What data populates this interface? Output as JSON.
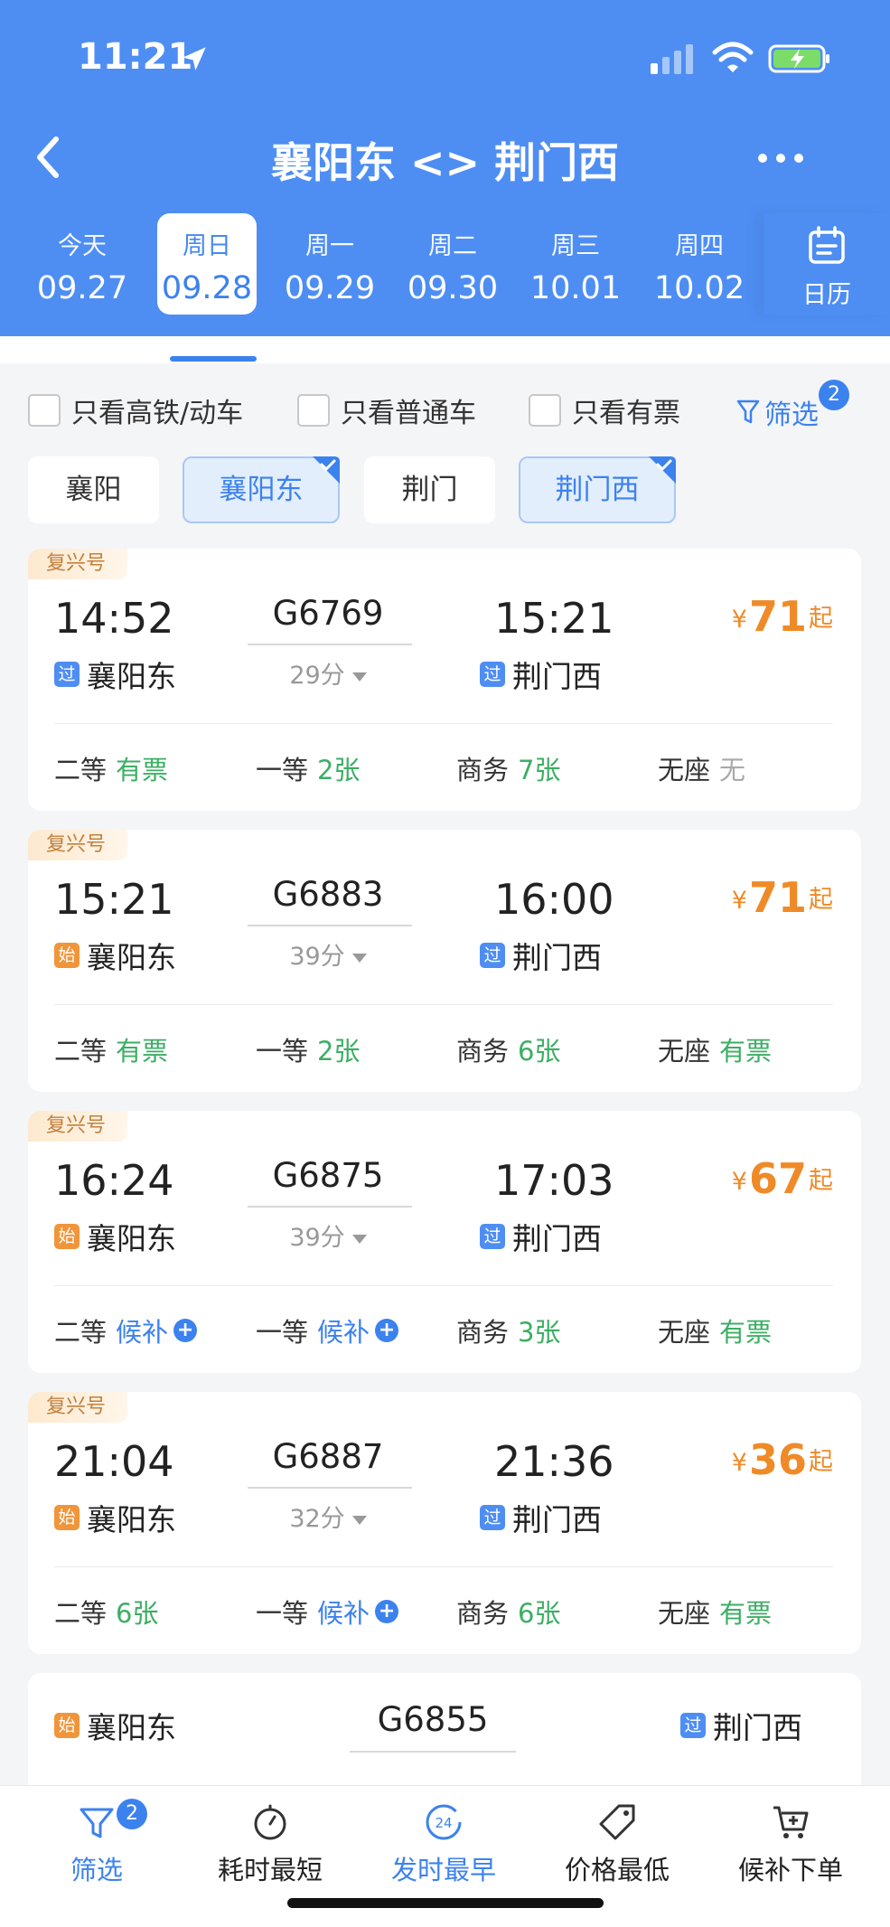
{
  "status": {
    "time": "11:21"
  },
  "nav": {
    "title": "襄阳东 <> 荆门西"
  },
  "dates": [
    {
      "weekday": "今天",
      "date": "09.27"
    },
    {
      "weekday": "周日",
      "date": "09.28",
      "selected": true
    },
    {
      "weekday": "周一",
      "date": "09.29"
    },
    {
      "weekday": "周二",
      "date": "09.30"
    },
    {
      "weekday": "周三",
      "date": "10.01"
    },
    {
      "weekday": "周四",
      "date": "10.02"
    }
  ],
  "calendar_label": "日历",
  "filters": {
    "high_speed": "只看高铁/动车",
    "regular": "只看普通车",
    "available": "只看有票",
    "filter_label": "筛选",
    "filter_count": "2"
  },
  "stations": [
    {
      "name": "襄阳",
      "selected": false
    },
    {
      "name": "襄阳东",
      "selected": true
    },
    {
      "name": "荆门",
      "selected": false
    },
    {
      "name": "荆门西",
      "selected": true
    }
  ],
  "trains": [
    {
      "tag": "复兴号",
      "depart": "14:52",
      "arrive": "15:21",
      "number": "G6769",
      "duration": "29分",
      "from_badge": "过",
      "from": "襄阳东",
      "to_badge": "过",
      "to": "荆门西",
      "price_symbol": "¥",
      "price": "71",
      "price_suffix": "起",
      "seats": [
        {
          "label": "二等",
          "value": "有票"
        },
        {
          "label": "一等",
          "value": "2张"
        },
        {
          "label": "商务",
          "value": "7张"
        },
        {
          "label": "无座",
          "value": "无"
        }
      ]
    },
    {
      "tag": "复兴号",
      "depart": "15:21",
      "arrive": "16:00",
      "number": "G6883",
      "duration": "39分",
      "from_badge": "始",
      "from": "襄阳东",
      "to_badge": "过",
      "to": "荆门西",
      "price_symbol": "¥",
      "price": "71",
      "price_suffix": "起",
      "seats": [
        {
          "label": "二等",
          "value": "有票"
        },
        {
          "label": "一等",
          "value": "2张"
        },
        {
          "label": "商务",
          "value": "6张"
        },
        {
          "label": "无座",
          "value": "有票"
        }
      ]
    },
    {
      "tag": "复兴号",
      "depart": "16:24",
      "arrive": "17:03",
      "number": "G6875",
      "duration": "39分",
      "from_badge": "始",
      "from": "襄阳东",
      "to_badge": "过",
      "to": "荆门西",
      "price_symbol": "¥",
      "price": "67",
      "price_suffix": "起",
      "seats": [
        {
          "label": "二等",
          "value": "候补"
        },
        {
          "label": "一等",
          "value": "候补"
        },
        {
          "label": "商务",
          "value": "3张"
        },
        {
          "label": "无座",
          "value": "有票"
        }
      ]
    },
    {
      "tag": "复兴号",
      "depart": "21:04",
      "arrive": "21:36",
      "number": "G6887",
      "duration": "32分",
      "from_badge": "始",
      "from": "襄阳东",
      "to_badge": "过",
      "to": "荆门西",
      "price_symbol": "¥",
      "price": "36",
      "price_suffix": "起",
      "seats": [
        {
          "label": "二等",
          "value": "6张"
        },
        {
          "label": "一等",
          "value": "候补"
        },
        {
          "label": "商务",
          "value": "6张"
        },
        {
          "label": "无座",
          "value": "有票"
        }
      ]
    },
    {
      "from_badge": "始",
      "from": "襄阳东",
      "number": "G6855",
      "to_badge": "过",
      "to": "荆门西"
    }
  ],
  "bottom": {
    "filter": "筛选",
    "filter_count": "2",
    "shortest": "耗时最短",
    "earliest": "发时最早",
    "earliest_icon_text": "24",
    "cheapest": "价格最低",
    "waitlist": "候补下单"
  },
  "colors": {
    "primary": "#4e8ef3",
    "accent_blue": "#3c82ef",
    "price": "#ef8a28",
    "available": "#3cae63",
    "tag_text": "#c2803d"
  },
  "icons": {
    "status": [
      "location-arrow-icon",
      "cellular-signal-icon",
      "wifi-icon",
      "battery-charging-icon"
    ],
    "nav": [
      "back-chevron-icon",
      "more-dots-icon",
      "calendar-icon"
    ],
    "filter": [
      "funnel-icon",
      "checkbox-icon",
      "check-corner-icon"
    ],
    "bottom": [
      "funnel-icon",
      "stopwatch-icon",
      "clock-24-icon",
      "price-tag-icon",
      "cart-icon"
    ]
  }
}
